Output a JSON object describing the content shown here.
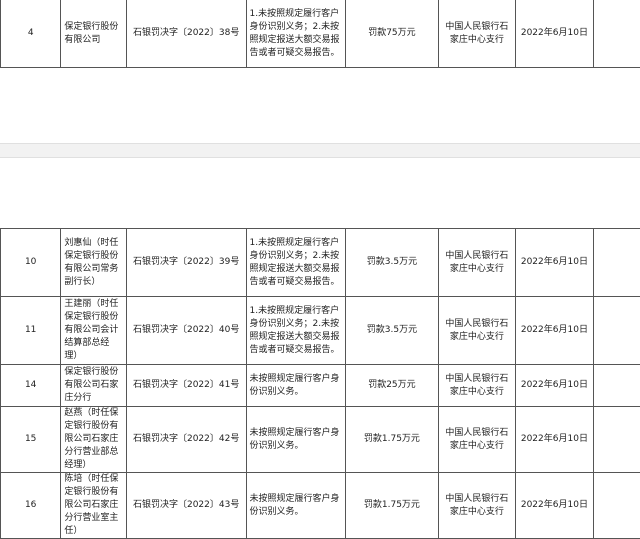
{
  "columns_note": "",
  "top_table": {
    "rows": [
      {
        "no": "4",
        "party": "保定银行股份有限公司",
        "doc": "石银罚决字〔2022〕38号",
        "violation": "1.未按照规定履行客户身份识别义务；2.未按照规定报送大额交易报告或者可疑交易报告。",
        "penalty": "罚款75万元",
        "authority": "中国人民银行石家庄中心支行",
        "date": "2022年6月10日"
      }
    ]
  },
  "bottom_table": {
    "rows": [
      {
        "no": "10",
        "party": "刘惠仙（时任保定银行股份有限公司常务副行长）",
        "doc": "石银罚决字〔2022〕39号",
        "violation": "1.未按照规定履行客户身份识别义务；2.未按照规定报送大额交易报告或者可疑交易报告。",
        "penalty": "罚款3.5万元",
        "authority": "中国人民银行石家庄中心支行",
        "date": "2022年6月10日"
      },
      {
        "no": "11",
        "party": "王建丽（时任保定银行股份有限公司会计结算部总经理）",
        "doc": "石银罚决字〔2022〕40号",
        "violation": "1.未按照规定履行客户身份识别义务；2.未按照规定报送大额交易报告或者可疑交易报告。",
        "penalty": "罚款3.5万元",
        "authority": "中国人民银行石家庄中心支行",
        "date": "2022年6月10日"
      },
      {
        "no": "14",
        "party": "保定银行股份有限公司石家庄分行",
        "doc": "石银罚决字〔2022〕41号",
        "violation": "未按照规定履行客户身份识别义务。",
        "penalty": "罚款25万元",
        "authority": "中国人民银行石家庄中心支行",
        "date": "2022年6月10日"
      },
      {
        "no": "15",
        "party": "赵燕（时任保定银行股份有限公司石家庄分行营业部总经理）",
        "doc": "石银罚决字〔2022〕42号",
        "violation": "未按照规定履行客户身份识别义务。",
        "penalty": "罚款1.75万元",
        "authority": "中国人民银行石家庄中心支行",
        "date": "2022年6月10日"
      },
      {
        "no": "16",
        "party": "陈培（时任保定银行股份有限公司石家庄分行营业室主任）",
        "doc": "石银罚决字〔2022〕43号",
        "violation": "未按照规定履行客户身份识别义务。",
        "penalty": "罚款1.75万元",
        "authority": "中国人民银行石家庄中心支行",
        "date": "2022年6月10日"
      }
    ]
  }
}
